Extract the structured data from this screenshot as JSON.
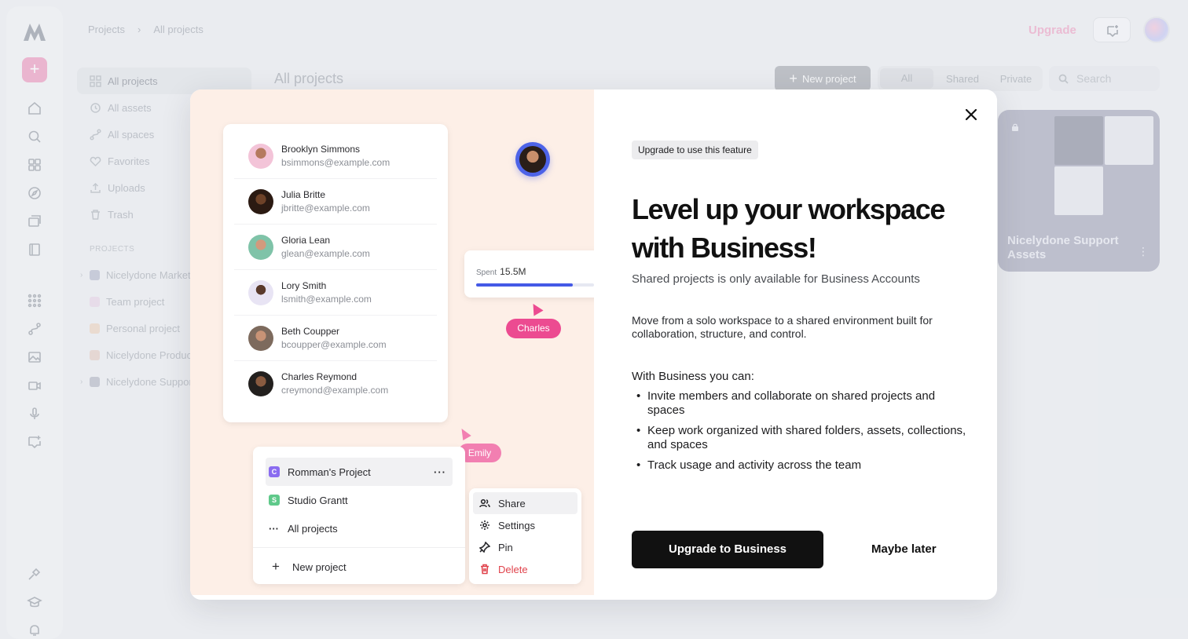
{
  "breadcrumb": [
    "Projects",
    "All projects"
  ],
  "header": {
    "upgrade_label": "Upgrade"
  },
  "nav": {
    "items": [
      "All projects",
      "All assets",
      "All spaces",
      "Favorites",
      "Uploads",
      "Trash"
    ],
    "projects_heading": "PROJECTS",
    "projects": [
      {
        "name": "Nicelydone Market",
        "color": "#b9bdd0"
      },
      {
        "name": "Team project",
        "color": "#ead7e8"
      },
      {
        "name": "Personal project",
        "color": "#efd6c2"
      },
      {
        "name": "Nicelydone Produc",
        "color": "#e6d0c6"
      },
      {
        "name": "Nicelydone Suppor",
        "color": "#b7bac7"
      }
    ]
  },
  "main": {
    "title": "All projects",
    "new_project_label": "New project",
    "filters": [
      "All",
      "Shared",
      "Private"
    ],
    "search_placeholder": "Search",
    "card_title": "Nicelydone Support Assets"
  },
  "modal": {
    "badge": "Upgrade to use this feature",
    "headline": "Level up your workspace with Business!",
    "subtitle": "Shared projects is only available for Business Accounts",
    "description": "Move from a solo workspace to a shared environment built for collaboration, structure, and control.",
    "with_business": "With Business you can:",
    "bullets": [
      "Invite members and collaborate on shared projects and spaces",
      "Keep work organized with shared folders, assets, collections, and spaces",
      "Track usage and activity across the team"
    ],
    "primary_cta": "Upgrade to Business",
    "secondary_cta": "Maybe later"
  },
  "illustration": {
    "users": [
      {
        "name": "Brooklyn Simmons",
        "email": "bsimmons@example.com"
      },
      {
        "name": "Julia Britte",
        "email": "jbritte@example.com"
      },
      {
        "name": "Gloria Lean",
        "email": "glean@example.com"
      },
      {
        "name": "Lory Smith",
        "email": "lsmith@example.com"
      },
      {
        "name": "Beth Coupper",
        "email": "bcoupper@example.com"
      },
      {
        "name": "Charles Reymond",
        "email": "creymond@example.com"
      }
    ],
    "spent_label": "Spent",
    "spent_value": "15.5M",
    "spent_fraction": 0.82,
    "cursor_1": "Charles",
    "cursor_2": "Emily",
    "projects": [
      {
        "badge": "C",
        "name": "Romman's Project"
      },
      {
        "badge": "S",
        "name": "Studio Grantt"
      },
      {
        "name": "All projects"
      }
    ],
    "new_project": "New project",
    "menu": [
      "Share",
      "Settings",
      "Pin",
      "Delete"
    ]
  },
  "colors": {
    "accent_pink": "#ec4b91",
    "accent_blue": "#4459e6",
    "cta_black": "#111111",
    "danger": "#e0434c"
  }
}
